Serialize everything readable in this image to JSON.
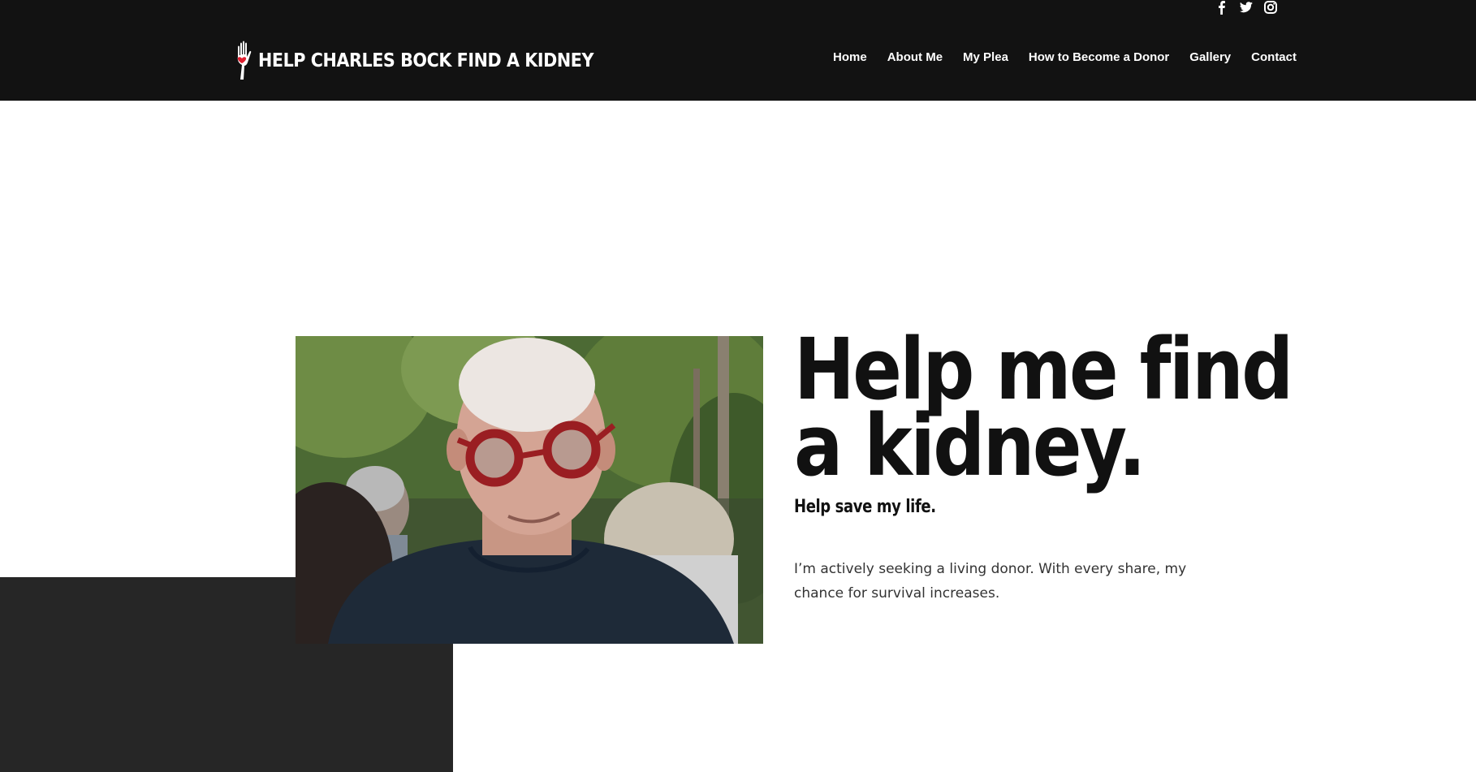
{
  "header": {
    "logo_text": "HELP CHARLES BOCK FIND A KIDNEY",
    "social_icons": [
      "facebook-icon",
      "twitter-icon",
      "instagram-icon"
    ],
    "nav": [
      {
        "label": "Home"
      },
      {
        "label": "About Me"
      },
      {
        "label": "My Plea"
      },
      {
        "label": "How to Become a Donor"
      },
      {
        "label": "Gallery"
      },
      {
        "label": "Contact"
      }
    ]
  },
  "hero": {
    "headline_line1": "Help me find",
    "headline_line2": "a kidney.",
    "subheadline": "Help save my life.",
    "body": "I’m actively seeking a living donor. With every share, my chance for survival increases."
  },
  "colors": {
    "header_bg": "#121212",
    "dark_block": "#262626",
    "heart": "#e02030",
    "text": "#111111"
  }
}
